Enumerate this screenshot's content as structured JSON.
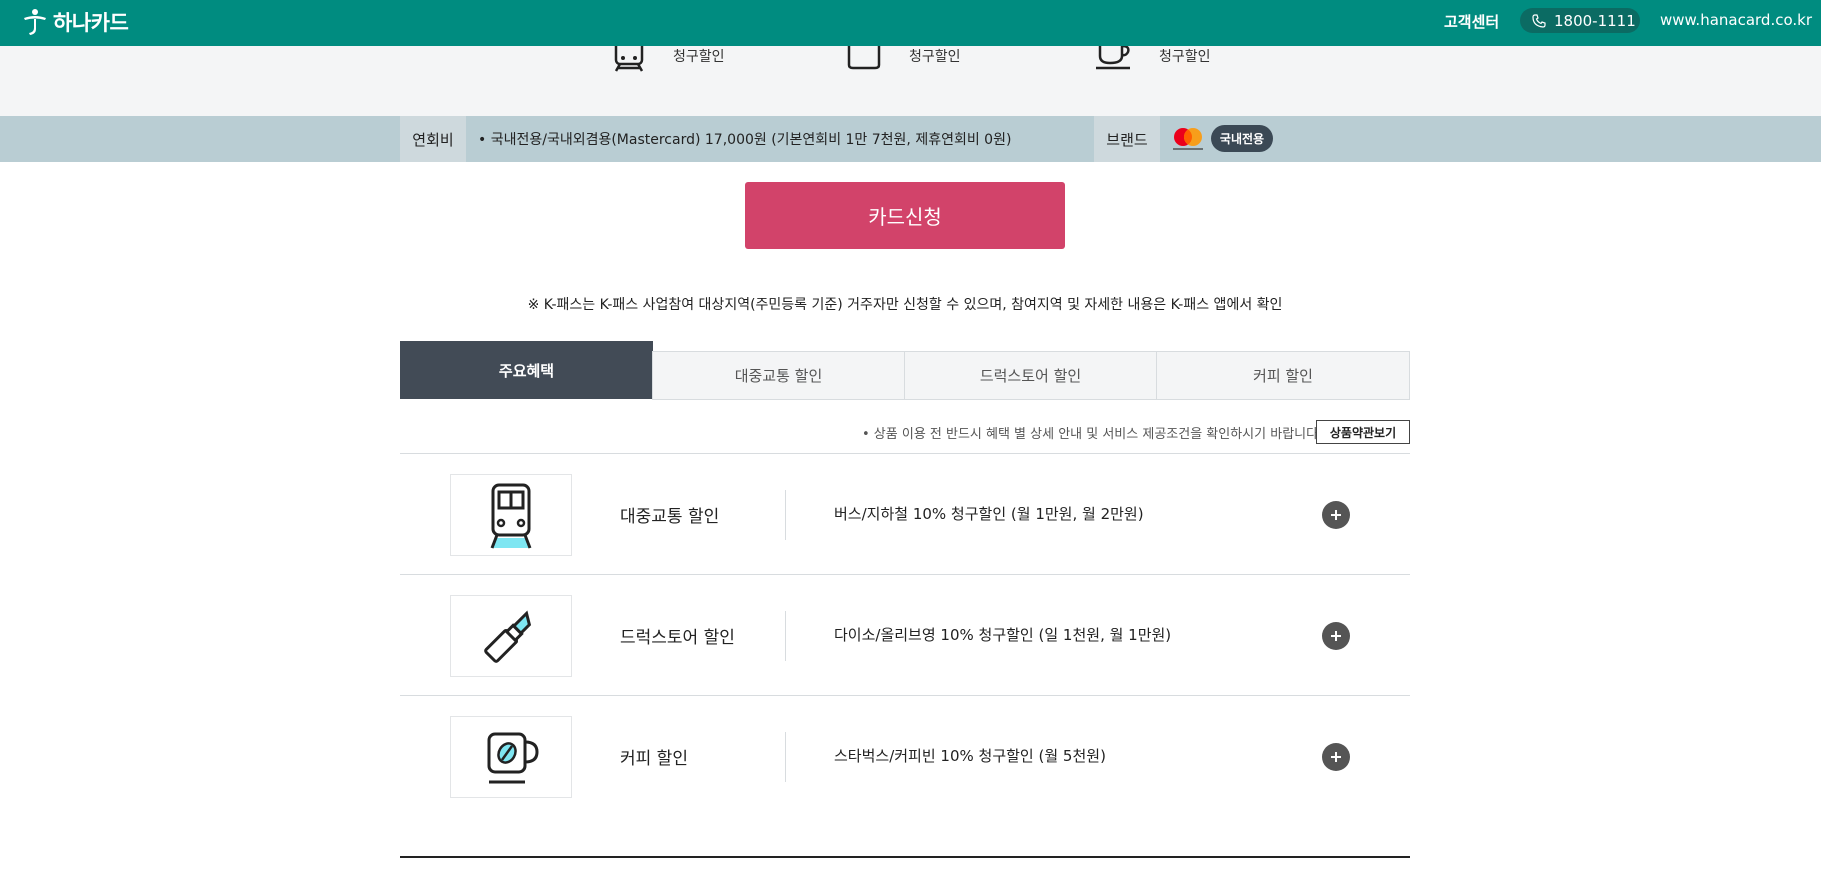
{
  "header": {
    "logo_text": "하나카드",
    "customer_center": "고객센터",
    "phone": "1800-1111",
    "site_url": "www.hanacard.co.kr",
    "brand_color": "#008c80"
  },
  "top_strip": {
    "items": [
      {
        "icon": "subway-icon",
        "label": "청구할인"
      },
      {
        "icon": "cosmetic-icon",
        "label": "청구할인"
      },
      {
        "icon": "coffee-icon",
        "label": "청구할인"
      }
    ]
  },
  "fee": {
    "label": "연회비",
    "text": "• 국내전용/국내외겸용(Mastercard) 17,000원 (기본연회비 1만 7천원, 제휴연회비 0원)"
  },
  "brand": {
    "label": "브랜드",
    "logo": "mastercard-icon",
    "domestic_badge": "국내전용"
  },
  "apply_button": {
    "label": "카드신청",
    "color": "#d2436a"
  },
  "notice": "※ K-패스는 K-패스 사업참여 대상지역(주민등록 기준) 거주자만 신청할 수 있으며, 참여지역 및 자세한 내용은 K-패스 앱에서 확인",
  "tabs": [
    {
      "label": "주요혜택",
      "active": true
    },
    {
      "label": "대중교통 할인",
      "active": false
    },
    {
      "label": "드럭스토어 할인",
      "active": false
    },
    {
      "label": "커피 할인",
      "active": false
    }
  ],
  "terms": {
    "note": "• 상품 이용 전 반드시 혜택 별 상세 안내 및 서비스 제공조건을 확인하시기 바랍니다.",
    "button": "상품약관보기"
  },
  "benefits": [
    {
      "icon": "train-icon",
      "title": "대중교통 할인",
      "desc": "버스/지하철 10% 청구할인 (월 1만원, 월 2만원)"
    },
    {
      "icon": "lipstick-icon",
      "title": "드럭스토어 할인",
      "desc": "다이소/올리브영 10% 청구할인 (일 1천원, 월 1만원)"
    },
    {
      "icon": "coffee-cup-icon",
      "title": "커피 할인",
      "desc": "스타벅스/커피빈 10% 청구할인 (월 5천원)"
    }
  ]
}
